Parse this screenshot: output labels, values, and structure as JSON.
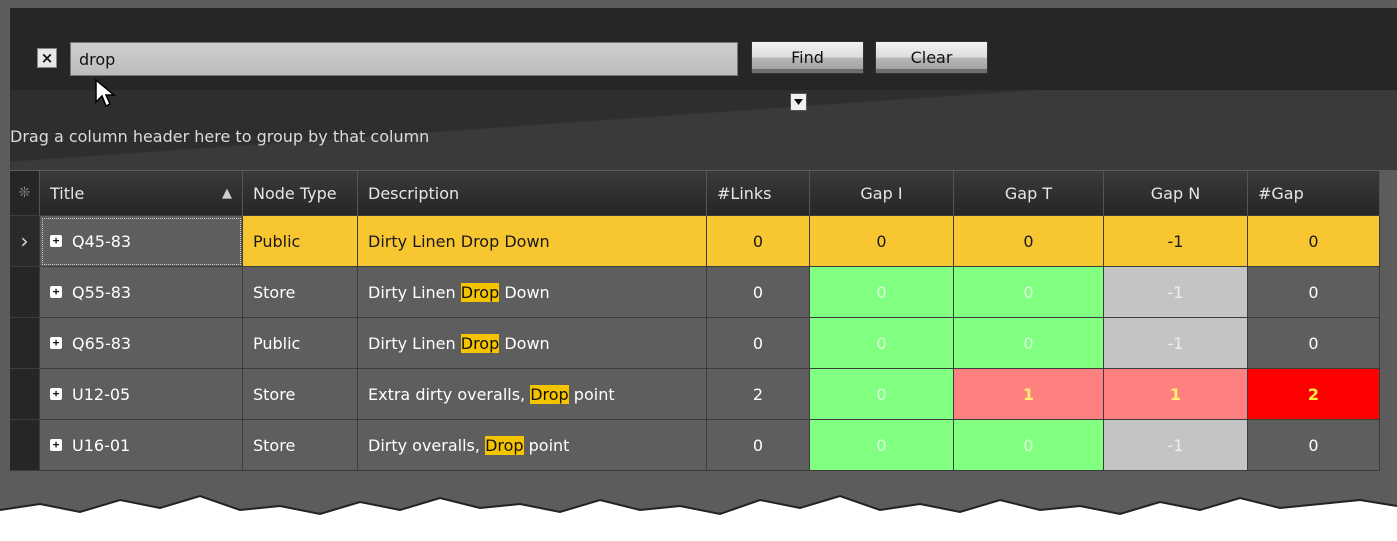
{
  "search": {
    "value": "drop",
    "find_label": "Find",
    "clear_label": "Clear",
    "close_glyph": "×"
  },
  "group_hint": "Drag a column header here to group by that column",
  "columns": {
    "indicator": "❊",
    "title": "Title",
    "sort_glyph": "▲",
    "node_type": "Node Type",
    "description": "Description",
    "links": "#Links",
    "gap_i": "Gap I",
    "gap_t": "Gap T",
    "gap_n": "Gap N",
    "num_gap": "#Gap"
  },
  "rows": [
    {
      "title": "Q45-83",
      "node_type": "Public",
      "desc_pre": "Dirty Linen ",
      "desc_hl": "Drop",
      "desc_post": " Down",
      "links": "0",
      "gap_i": "0",
      "gap_t": "0",
      "gap_n": "-1",
      "num_gap": "0",
      "current": "›"
    },
    {
      "title": "Q55-83",
      "node_type": "Store",
      "desc_pre": "Dirty Linen ",
      "desc_hl": "Drop",
      "desc_post": " Down",
      "links": "0",
      "gap_i": "0",
      "gap_t": "0",
      "gap_n": "-1",
      "num_gap": "0"
    },
    {
      "title": "Q65-83",
      "node_type": "Public",
      "desc_pre": "Dirty Linen ",
      "desc_hl": "Drop",
      "desc_post": " Down",
      "links": "0",
      "gap_i": "0",
      "gap_t": "0",
      "gap_n": "-1",
      "num_gap": "0"
    },
    {
      "title": "U12-05",
      "node_type": "Store",
      "desc_pre": "Extra dirty overalls, ",
      "desc_hl": "Drop",
      "desc_post": " point",
      "links": "2",
      "gap_i": "0",
      "gap_t": "1",
      "gap_n": "1",
      "num_gap": "2"
    },
    {
      "title": "U16-01",
      "node_type": "Store",
      "desc_pre": "Dirty overalls, ",
      "desc_hl": "Drop",
      "desc_post": " point",
      "links": "0",
      "gap_i": "0",
      "gap_t": "0",
      "gap_n": "-1",
      "num_gap": "0"
    }
  ],
  "colors": {
    "selected_row": "#f7c630",
    "ok": "#80ff80",
    "neutral": "#c4c4c4",
    "warn": "#ff8080",
    "alert": "#ff0000",
    "match_highlight": "#f5c400"
  }
}
